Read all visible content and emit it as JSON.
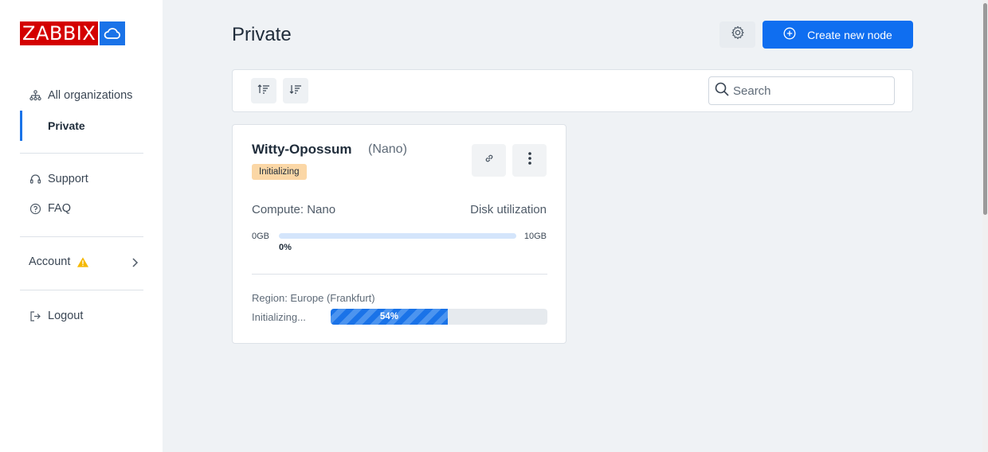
{
  "brand": {
    "logo_text": "ZABBIX",
    "logo_red": "#d40000",
    "logo_blue": "#1a73e8"
  },
  "sidebar": {
    "all_orgs": {
      "label": "All organizations",
      "icon": "org-tree-icon"
    },
    "private": {
      "label": "Private"
    },
    "support": {
      "label": "Support",
      "icon": "headset-icon"
    },
    "faq": {
      "label": "FAQ",
      "icon": "question-circle-icon"
    },
    "account": {
      "label": "Account",
      "icon": "warning-icon",
      "warning_color": "#f5b800"
    },
    "logout": {
      "label": "Logout",
      "icon": "logout-icon"
    }
  },
  "header": {
    "title": "Private",
    "settings_icon": "gear-icon",
    "create_label": "Create new node",
    "accent": "#0f6ef0"
  },
  "toolbar": {
    "sort_asc_icon": "sort-ascending-icon",
    "sort_desc_icon": "sort-descending-icon",
    "search_placeholder": "Search"
  },
  "node": {
    "name": "Witty-Opossum",
    "size": "(Nano)",
    "status": "Initializing",
    "status_color": "#fbd7a6",
    "compute_label": "Compute: Nano",
    "disk_label": "Disk utilization",
    "disk_min": "0GB",
    "disk_max": "10GB",
    "disk_percent_label": "0%",
    "disk_fraction": 0,
    "region": "Region: Europe (Frankfurt)",
    "init_label": "Initializing...",
    "init_percent_label": "54%",
    "init_fraction": 0.54
  }
}
